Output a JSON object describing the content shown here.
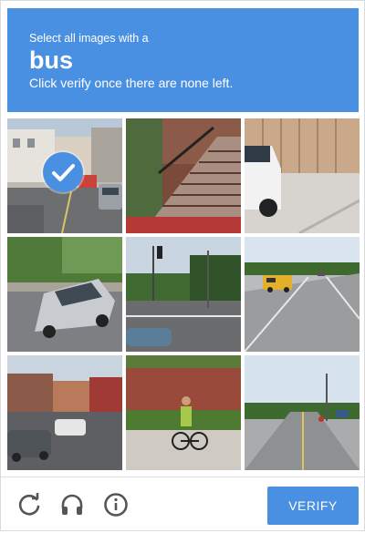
{
  "header": {
    "instruction": "Select all images with a",
    "target": "bus",
    "note": "Click verify once there are none left."
  },
  "tiles": [
    {
      "id": 1,
      "selected": true
    },
    {
      "id": 2,
      "selected": false
    },
    {
      "id": 3,
      "selected": false
    },
    {
      "id": 4,
      "selected": false
    },
    {
      "id": 5,
      "selected": false
    },
    {
      "id": 6,
      "selected": false
    },
    {
      "id": 7,
      "selected": false
    },
    {
      "id": 8,
      "selected": false
    },
    {
      "id": 9,
      "selected": false
    }
  ],
  "footer": {
    "reload_icon": "reload-icon",
    "audio_icon": "headphones-icon",
    "info_icon": "info-icon",
    "verify_label": "VERIFY"
  },
  "colors": {
    "accent": "#4a90e2"
  }
}
